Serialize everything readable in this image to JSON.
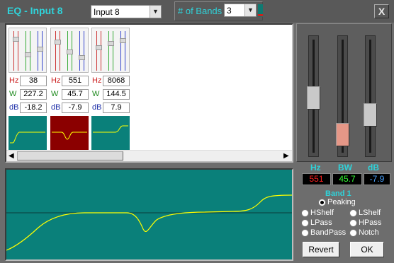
{
  "window": {
    "title": "EQ - Input 8",
    "preset_value": "Input 8",
    "bands_label": "# of Bands",
    "bands_value": "3",
    "close_label": "X"
  },
  "band_strips": [
    {
      "hz": "38",
      "w": "227.2",
      "db": "-18.2",
      "selected": false
    },
    {
      "hz": "551",
      "w": "45.7",
      "db": "-7.9",
      "selected": true
    },
    {
      "hz": "8068",
      "w": "144.5",
      "db": "7.9",
      "selected": false
    }
  ],
  "labels": {
    "hz": "Hz",
    "w": "W",
    "db": "dB"
  },
  "faders": {
    "hz_label": "Hz",
    "bw_label": "BW",
    "db_label": "dB",
    "hz_value": "551",
    "bw_value": "45.7",
    "db_value": "-7.9"
  },
  "band_type": {
    "title": "Band 1",
    "options": [
      "Peaking",
      "HShelf",
      "LShelf",
      "LPass",
      "HPass",
      "BandPass",
      "Notch"
    ],
    "selected": "Peaking"
  },
  "buttons": {
    "revert": "Revert",
    "ok": "OK"
  },
  "colors": {
    "accent": "#2fd3da",
    "graph_bg": "#0a807a",
    "curve": "#ffff00",
    "selected_band": "#8b0000",
    "hz_readout": "#ff2020",
    "bw_readout": "#33ff33",
    "db_readout": "#4aa3ff"
  },
  "icons": {
    "dropdown": "chevron-down-icon",
    "scroll_left": "arrow-left-icon",
    "scroll_right": "arrow-right-icon"
  }
}
